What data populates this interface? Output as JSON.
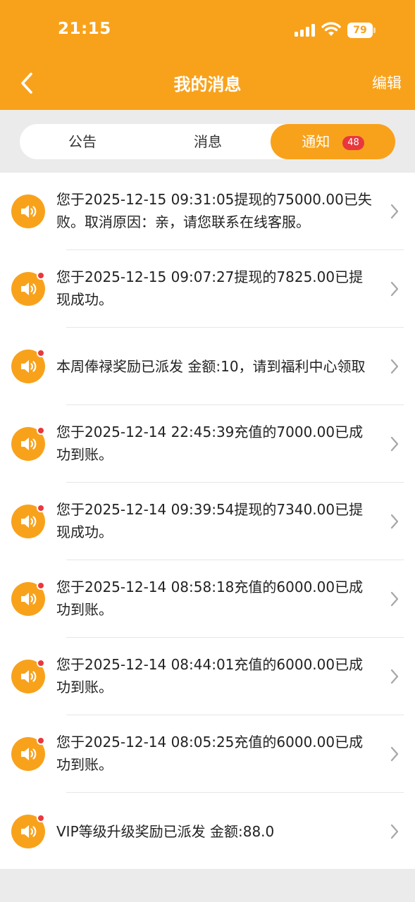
{
  "status_bar": {
    "time": "21:15",
    "battery": "79"
  },
  "nav": {
    "title": "我的消息",
    "edit_label": "编辑"
  },
  "tabs": [
    {
      "label": "公告"
    },
    {
      "label": "消息"
    },
    {
      "label": "通知",
      "badge": "48",
      "active": true
    }
  ],
  "messages": [
    {
      "text": "您于2025-12-15 09:31:05提现的75000.00已失败。取消原因：亲，请您联系在线客服。",
      "unread": false
    },
    {
      "text": "您于2025-12-15 09:07:27提现的7825.00已提现成功。",
      "unread": true
    },
    {
      "text": "本周俸禄奖励已派发 金额:10，请到福利中心领取",
      "unread": true
    },
    {
      "text": "您于2025-12-14 22:45:39充值的7000.00已成功到账。",
      "unread": true
    },
    {
      "text": "您于2025-12-14 09:39:54提现的7340.00已提现成功。",
      "unread": true
    },
    {
      "text": "您于2025-12-14 08:58:18充值的6000.00已成功到账。",
      "unread": true
    },
    {
      "text": "您于2025-12-14 08:44:01充值的6000.00已成功到账。",
      "unread": true
    },
    {
      "text": "您于2025-12-14 08:05:25充值的6000.00已成功到账。",
      "unread": true
    },
    {
      "text": "VIP等级升级奖励已派发 金额:88.0",
      "unread": true
    }
  ],
  "colors": {
    "accent": "#f8a21b",
    "badge_red": "#e8383d"
  },
  "icons": {
    "message": "speaker-icon",
    "row_action": "chevron-right-icon",
    "back": "chevron-left-icon"
  }
}
